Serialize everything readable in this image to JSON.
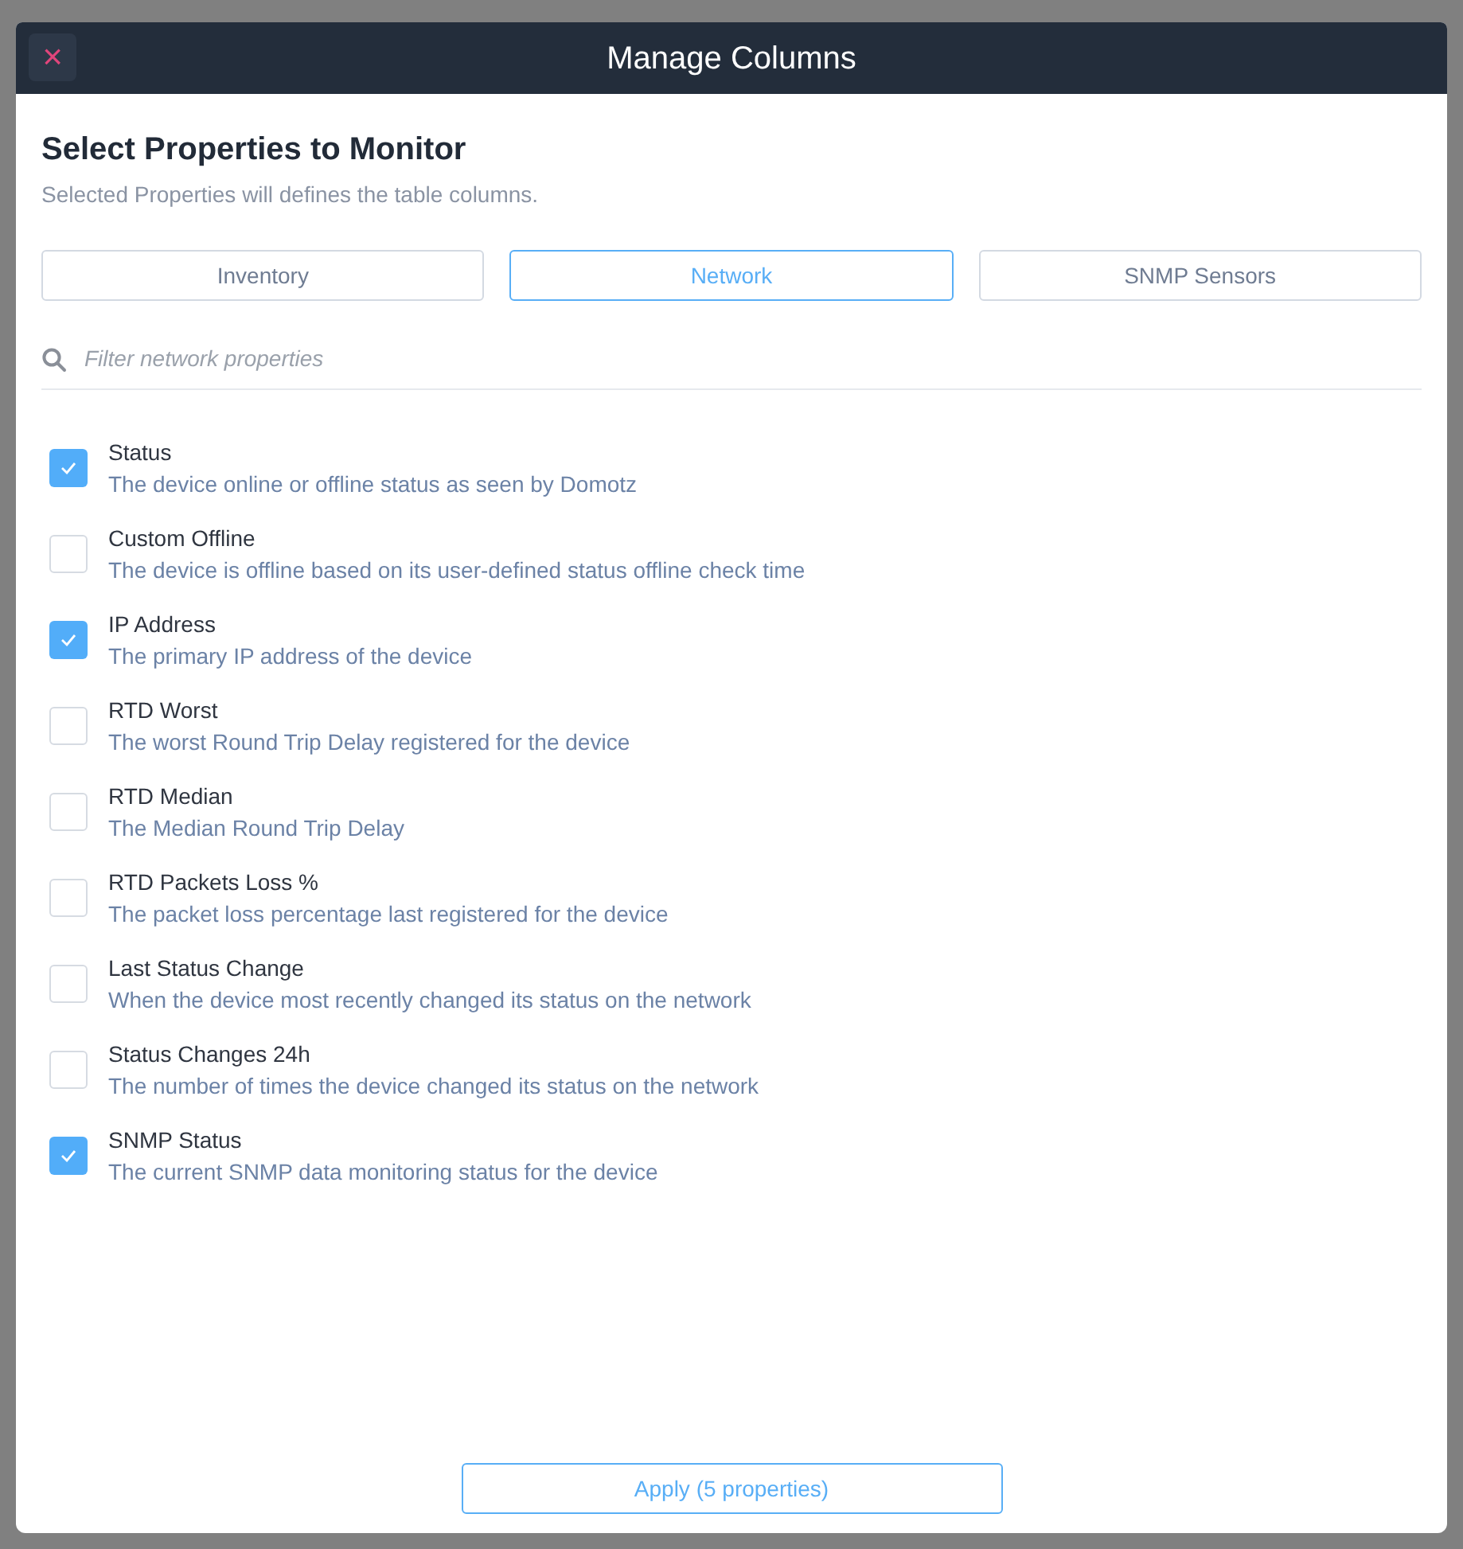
{
  "dialog": {
    "title": "Manage Columns",
    "close_icon": "×"
  },
  "heading": "Select Properties to Monitor",
  "subheading": "Selected Properties will defines the table columns.",
  "tabs": [
    {
      "label": "Inventory",
      "selected": false
    },
    {
      "label": "Network",
      "selected": true
    },
    {
      "label": "SNMP Sensors",
      "selected": false
    }
  ],
  "filter": {
    "placeholder": "Filter network properties"
  },
  "properties": [
    {
      "name": "Status",
      "description": "The device online or offline status as seen by Domotz",
      "checked": true
    },
    {
      "name": "Custom Offline",
      "description": "The device is offline based on its user-defined status offline check time",
      "checked": false
    },
    {
      "name": "IP Address",
      "description": "The primary IP address of the device",
      "checked": true
    },
    {
      "name": "RTD Worst",
      "description": "The worst Round Trip Delay registered for the device",
      "checked": false
    },
    {
      "name": "RTD Median",
      "description": "The Median Round Trip Delay",
      "checked": false
    },
    {
      "name": "RTD Packets Loss %",
      "description": "The packet loss percentage last registered for the device",
      "checked": false
    },
    {
      "name": "Last Status Change",
      "description": "When the device most recently changed its status on the network",
      "checked": false
    },
    {
      "name": "Status Changes 24h",
      "description": "The number of times the device changed its status on the network",
      "checked": false
    },
    {
      "name": "SNMP Status",
      "description": "The current SNMP data monitoring status for the device",
      "checked": true
    }
  ],
  "apply_button": "Apply (5 properties)"
}
